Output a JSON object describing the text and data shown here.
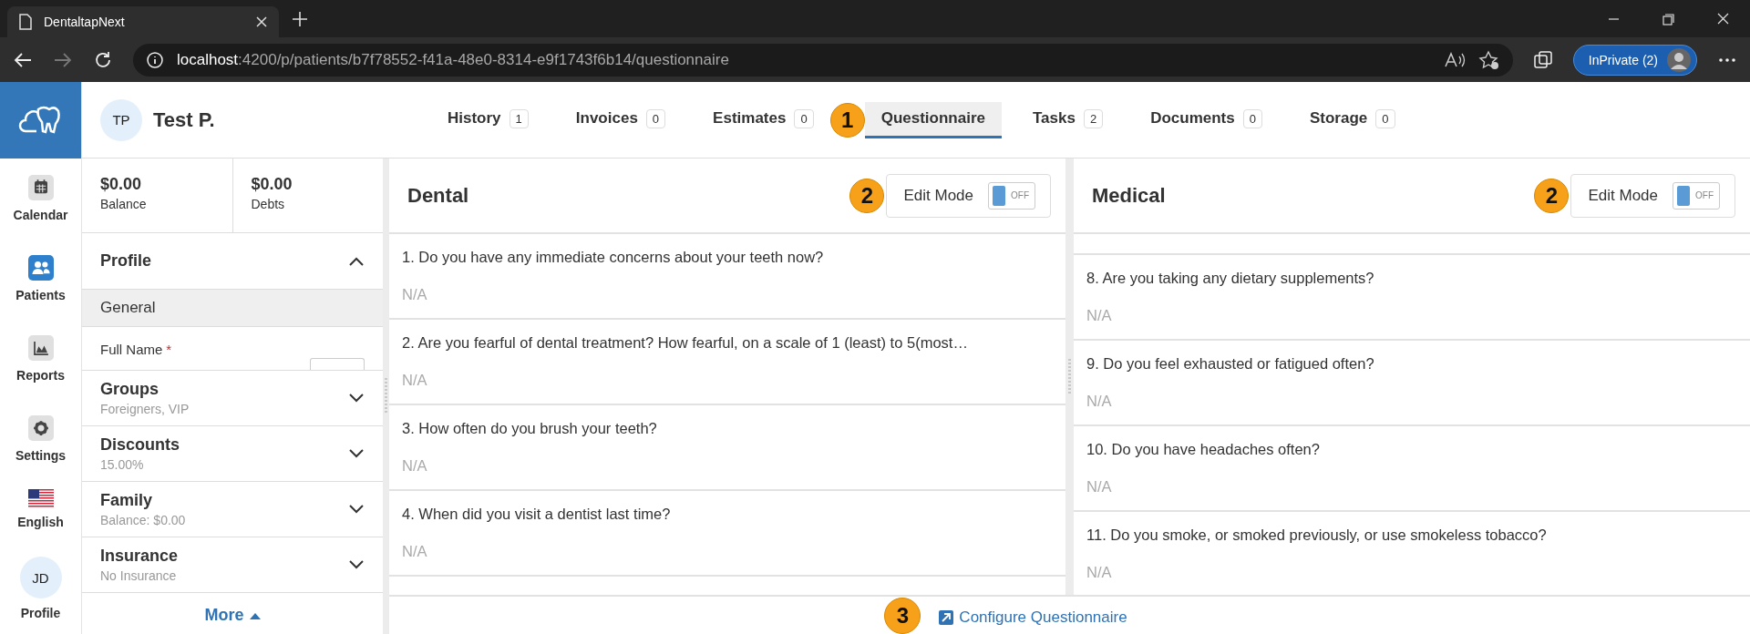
{
  "browser": {
    "tab_title": "DentaltapNext",
    "url_host": "localhost",
    "url_path": ":4200/p/patients/b7f78552-f41a-48e0-8314-e9f1743f6b14/questionnaire",
    "profile_button": "InPrivate (2)"
  },
  "nav": {
    "items": [
      {
        "label": "Calendar",
        "kind": "calendar",
        "selected": false
      },
      {
        "label": "Patients",
        "kind": "people",
        "selected": true
      },
      {
        "label": "Reports",
        "kind": "chart",
        "selected": false
      },
      {
        "label": "Settings",
        "kind": "gear",
        "selected": false
      },
      {
        "label": "English",
        "kind": "flag",
        "selected": false
      }
    ],
    "user": {
      "initials": "JD",
      "label": "Profile"
    }
  },
  "patient": {
    "initials": "TP",
    "name": "Test P."
  },
  "tabs": [
    {
      "label": "History",
      "count": "1",
      "selected": false
    },
    {
      "label": "Invoices",
      "count": "0",
      "selected": false
    },
    {
      "label": "Estimates",
      "count": "0",
      "selected": false
    },
    {
      "label": "Questionnaire",
      "selected": true,
      "callout": "1"
    },
    {
      "label": "Tasks",
      "count": "2",
      "selected": false
    },
    {
      "label": "Documents",
      "count": "0",
      "selected": false
    },
    {
      "label": "Storage",
      "count": "0",
      "selected": false
    }
  ],
  "summary": [
    {
      "amount": "$0.00",
      "label": "Balance"
    },
    {
      "amount": "$0.00",
      "label": "Debts"
    }
  ],
  "profile": {
    "title": "Profile",
    "expanded": true,
    "section": "General",
    "field_label": "Full Name",
    "required_mark": "*"
  },
  "sections": [
    {
      "title": "Groups",
      "subtitle": "Foreigners, VIP",
      "expanded": false
    },
    {
      "title": "Discounts",
      "subtitle": "15.00%",
      "expanded": false
    },
    {
      "title": "Family",
      "subtitle": "Balance: $0.00",
      "expanded": false
    },
    {
      "title": "Insurance",
      "subtitle": "No Insurance",
      "expanded": false
    }
  ],
  "more": "More",
  "panels": [
    {
      "title": "Dental",
      "edit_mode": {
        "label": "Edit Mode",
        "on": false,
        "state_text": "OFF",
        "callout": "2"
      },
      "questions": [
        {
          "text": "1. Do you have any immediate concerns about your teeth now?",
          "answer": "N/A"
        },
        {
          "text": "2. Are you fearful of dental treatment? How fearful, on a scale of 1 (least) to 5(most…",
          "answer": "N/A"
        },
        {
          "text": "3. How often do you brush your teeth?",
          "answer": "N/A"
        },
        {
          "text": "4. When did you visit a dentist last time?",
          "answer": "N/A"
        }
      ]
    },
    {
      "title": "Medical",
      "edit_mode": {
        "label": "Edit Mode",
        "on": false,
        "state_text": "OFF",
        "callout": "2"
      },
      "cut_top": true,
      "questions": [
        {
          "text": "8. Are you taking any dietary supplements?",
          "answer": "N/A"
        },
        {
          "text": "9. Do you feel exhausted or fatigued often?",
          "answer": "N/A"
        },
        {
          "text": "10. Do you have headaches often?",
          "answer": "N/A"
        },
        {
          "text": "11. Do you smoke, or smoked previously, or use smokeless tobacco?",
          "answer": "N/A"
        }
      ]
    }
  ],
  "footer": {
    "link": "Configure Questionnaire",
    "callout": "3"
  }
}
